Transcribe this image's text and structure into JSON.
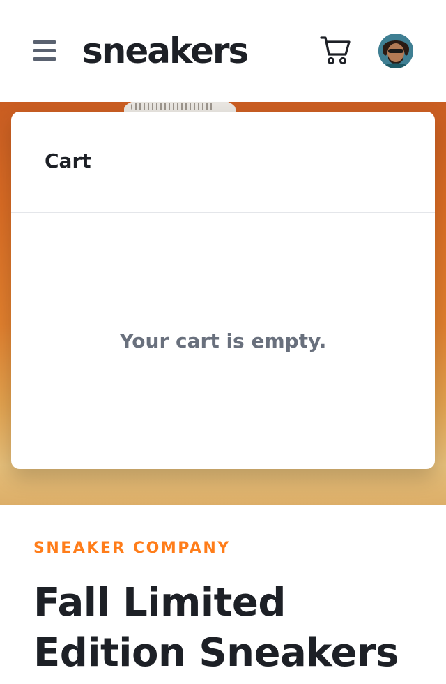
{
  "header": {
    "logo": "sneakers",
    "menu_icon": "hamburger-menu-icon",
    "cart_icon": "cart-icon",
    "avatar_alt": "user avatar"
  },
  "cart": {
    "title": "Cart",
    "empty_message": "Your cart is empty."
  },
  "product": {
    "company": "SNEAKER COMPANY",
    "title": "Fall Limited Edition Sneakers"
  },
  "colors": {
    "accent": "#ff7d1a",
    "text_dark": "#1d2026",
    "text_muted": "#69707d"
  }
}
